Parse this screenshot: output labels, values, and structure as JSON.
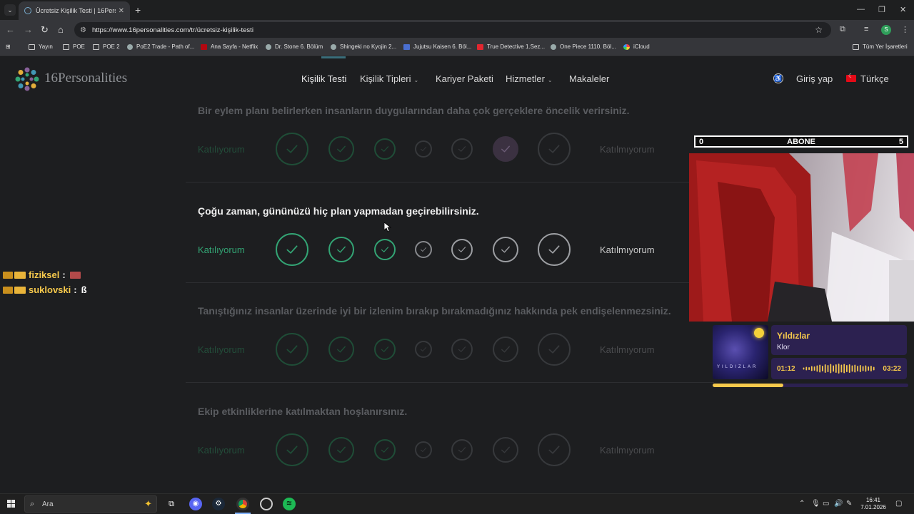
{
  "browser": {
    "tab_title": "Ücretsiz Kişilik Testi | 16Personalities",
    "url": "https://www.16personalities.com/tr/ücretsiz-kişilik-testi",
    "profile_initial": "S",
    "bookmarks": [
      "Yayın",
      "POE",
      "POE 2",
      "PoE2 Trade - Path of...",
      "Ana Sayfa - Netflix",
      "Dr. Stone 6. Bölüm",
      "Shingeki no Kyojin 2...",
      "Jujutsu Kaisen 6. Böl...",
      "True Detective 1.Sez...",
      "One Piece 1110. Böl...",
      "iCloud"
    ],
    "all_bookmarks": "Tüm Yer İşaretleri"
  },
  "site": {
    "logo_text": "16Personalities",
    "nav": {
      "test": "Kişilik Testi",
      "types": "Kişilik Tipleri",
      "career": "Kariyer Paketi",
      "services": "Hizmetler",
      "articles": "Makaleler",
      "login": "Giriş yap",
      "language": "Türkçe"
    },
    "agree_label": "Katılıyorum",
    "disagree_label": "Katılmıyorum",
    "questions": [
      {
        "text": "Bir eylem planı belirlerken insanların duygularından daha çok gerçeklere öncelik verirsiniz.",
        "state": "answered",
        "selected": 6
      },
      {
        "text": "Çoğu zaman, gününüzü hiç plan yapmadan geçirebilirsiniz.",
        "state": "active",
        "selected": 0
      },
      {
        "text": "Tanıştığınız insanlar üzerinde iyi bir izlenim bırakıp bırakmadığınız hakkında pek endişelenmezsiniz.",
        "state": "upcoming",
        "selected": 0
      },
      {
        "text": "Ekip etkinliklerine katılmaktan hoşlanırsınız.",
        "state": "upcoming",
        "selected": 0
      }
    ]
  },
  "overlay": {
    "sub_goal": {
      "current": "0",
      "label": "ABONE",
      "target": "5"
    },
    "music": {
      "title": "Yıldızlar",
      "artist": "Klor",
      "elapsed": "01:12",
      "duration": "03:22",
      "progress": 0.36,
      "cover_text": "YILDIZLAR"
    },
    "chat": [
      {
        "user": "fiziksel",
        "message": ""
      },
      {
        "user": "suklovski",
        "message": "ß"
      }
    ]
  },
  "taskbar": {
    "search_placeholder": "Ara",
    "time": "16:41",
    "date": "7.01.2026"
  },
  "colors": {
    "accent_green": "#33a474",
    "overlay_yellow": "#f6c94c",
    "overlay_purple": "#2c2150"
  }
}
